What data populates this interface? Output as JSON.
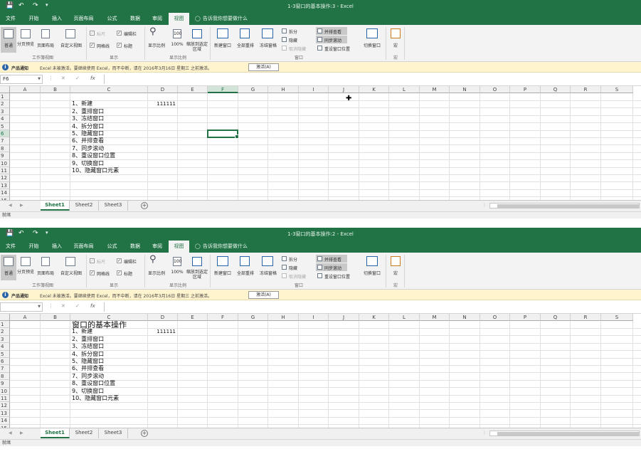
{
  "windows": [
    {
      "title": "1-3窗口的基本操作:3 - Excel",
      "name_box": "F6",
      "has_title_cell": false,
      "selected_col": "F",
      "selected_row": "6"
    },
    {
      "title": "1-3窗口的基本操作:2 - Excel",
      "name_box": "",
      "has_title_cell": true,
      "selected_col": "",
      "selected_row": ""
    }
  ],
  "tabs": [
    "文件",
    "开始",
    "插入",
    "页面布局",
    "公式",
    "数据",
    "审阅",
    "视图"
  ],
  "active_tab": "视图",
  "tell_me": "告诉我你想要做什么",
  "ribbon": {
    "normal": "普通",
    "page_break": "分页预览",
    "page_layout": "页面布局",
    "custom_views": "自定义视图",
    "group_workbook_views": "工作簿视图",
    "ruler": "标尺",
    "formula_bar": "编辑栏",
    "gridlines": "网格线",
    "headings": "标题",
    "group_show": "显示",
    "zoom": "显示比例",
    "zoom100": "100%",
    "zoom_selection": "缩放到选定区域",
    "group_zoom": "显示比例",
    "new_window": "新建窗口",
    "arrange_all": "全部重排",
    "freeze": "冻结窗格",
    "split": "拆分",
    "hide": "隐藏",
    "unhide": "取消隐藏",
    "side_by_side": "并排查看",
    "sync_scroll": "同步滚动",
    "reset_position": "重设窗口位置",
    "group_window": "窗口",
    "switch_windows": "切换窗口",
    "macros": "宏",
    "group_macros": "宏"
  },
  "notice": {
    "title": "产品通知",
    "text": "Excel 未被激活。要继续使用 Excel，而不中断，请在 2016年3月16日 星期三 之前激活。",
    "button": "激活(A)"
  },
  "fx": "fx",
  "columns": [
    "A",
    "B",
    "C",
    "D",
    "E",
    "F",
    "G",
    "H",
    "I",
    "J",
    "K",
    "L",
    "M",
    "N",
    "O",
    "P",
    "Q",
    "R",
    "S"
  ],
  "rows": [
    "1",
    "2",
    "3",
    "4",
    "5",
    "6",
    "7",
    "8",
    "9",
    "10",
    "11",
    "12",
    "13",
    "14",
    "15"
  ],
  "title_cell": "窗口的基本操作",
  "d2_value": "111111",
  "list_items": [
    "1、新建",
    "2、重排窗口",
    "3、冻结窗口",
    "4、拆分窗口",
    "5、隐藏窗口",
    "6、并排查看",
    "7、同步滚动",
    "8、重设窗口位置",
    "9、切换窗口",
    "10、隐藏窗口元素"
  ],
  "sheets": [
    "Sheet1",
    "Sheet2",
    "Sheet3"
  ],
  "active_sheet": "Sheet1",
  "status": "就绪"
}
